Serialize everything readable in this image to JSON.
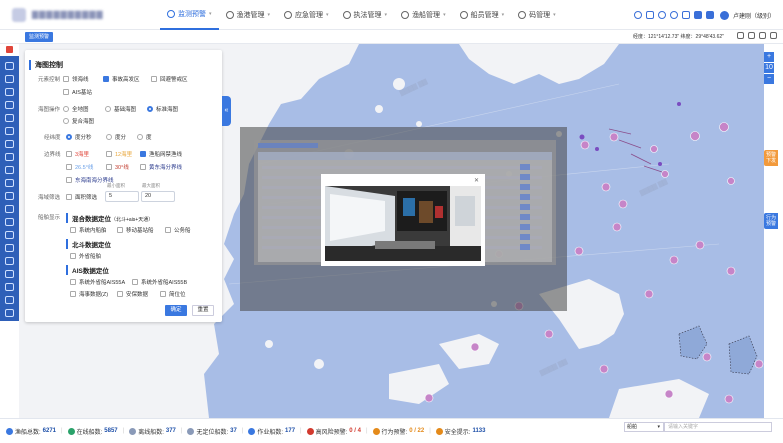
{
  "header": {
    "nav": [
      {
        "label": "监测预警",
        "icon": "monitor-icon",
        "active": true
      },
      {
        "label": "渔港管理",
        "icon": "harbor-icon",
        "active": false
      },
      {
        "label": "应急管理",
        "icon": "emergency-icon",
        "active": false
      },
      {
        "label": "执法管理",
        "icon": "law-icon",
        "active": false
      },
      {
        "label": "渔船管理",
        "icon": "ship-icon",
        "active": false
      },
      {
        "label": "船员管理",
        "icon": "crew-icon",
        "active": false
      },
      {
        "label": "码管理",
        "icon": "code-icon",
        "active": false
      }
    ],
    "user": "卢建刚（级别）"
  },
  "subbar": {
    "tab": "监测预警",
    "coords": "经度：121°14'12.73\"  纬度：29°48'43.62\""
  },
  "panel": {
    "title": "海图控制",
    "rows": {
      "layer_label": "元素控制",
      "layer_opts": [
        "领海线",
        "事故高发区",
        "回避警戒区"
      ],
      "layer_opt4": "AIS基站",
      "chart_label": "海图操作",
      "chart_opts": [
        "全地图",
        "基础海图",
        "标准海图"
      ],
      "chart_opt4": "复合海图",
      "format_label": "经纬度",
      "format_opts": [
        "度分秒",
        "度分",
        "度"
      ],
      "line_label": "边界线",
      "line_opts": [
        "3海里",
        "12海里",
        "渔船网禁渔线"
      ],
      "line_opts2": [
        "26.5°线",
        "30°线",
        "黄东海分界线"
      ],
      "line_opt7": "东海南海分界线",
      "zone_label": "海域筛选",
      "zone_opt": "面积筛选",
      "min_cap": "最小面积",
      "max_cap": "最大面积",
      "min_val": "5",
      "max_val": "20",
      "ship_label": "船舶显示",
      "sec1_title": "混合数据定位",
      "sec1_sub": "（北斗+ais+天通）",
      "sec1_opts": [
        "系统内船舶",
        "移动基站船",
        "公务船"
      ],
      "sec2_title": "北斗数据定位",
      "sec2_opts": [
        "外省船舶"
      ],
      "sec3_title": "AIS数据定位",
      "sec3_opts": [
        "系统外省船AIS55A",
        "系统外省船AIS55B"
      ],
      "sec3_opts2": [
        "海事数据(Z)",
        "安保数据",
        "简位位"
      ]
    },
    "confirm": "确定",
    "reset": "重置"
  },
  "map_side_buttons": {
    "plus": "+",
    "level": "10",
    "minus": "−",
    "btn1": "预警\n下发",
    "btn2": "行为\n预警"
  },
  "status": [
    {
      "label": "渔船总数:",
      "value": "6271",
      "color": "#3a78e0",
      "tone": "blue"
    },
    {
      "label": "在线船数:",
      "value": "5857",
      "color": "#2aa26a",
      "tone": "blue"
    },
    {
      "label": "离线船数:",
      "value": "377",
      "color": "#8a9ab8",
      "tone": "blue"
    },
    {
      "label": "无定位船数:",
      "value": "37",
      "color": "#8a9ab8",
      "tone": "blue"
    },
    {
      "label": "作业船数:",
      "value": "177",
      "color": "#3a78e0",
      "tone": "blue"
    },
    {
      "label": "高风险预警:",
      "value": "0 / 4",
      "color": "#d23a2e",
      "tone": "red"
    },
    {
      "label": "行为预警:",
      "value": "0 / 22",
      "color": "#e48a1a",
      "tone": "orange"
    },
    {
      "label": "安全提示:",
      "value": "1133",
      "color": "#e48a1a",
      "tone": "blue"
    }
  ],
  "bottom": {
    "select": "船舶",
    "search_placeholder": "请输入关键字"
  },
  "colors": {
    "accent": "#3a78e0",
    "sidebar": "#2e5fb8",
    "sea": "#a8bde6",
    "land": "#f2f3f6"
  }
}
